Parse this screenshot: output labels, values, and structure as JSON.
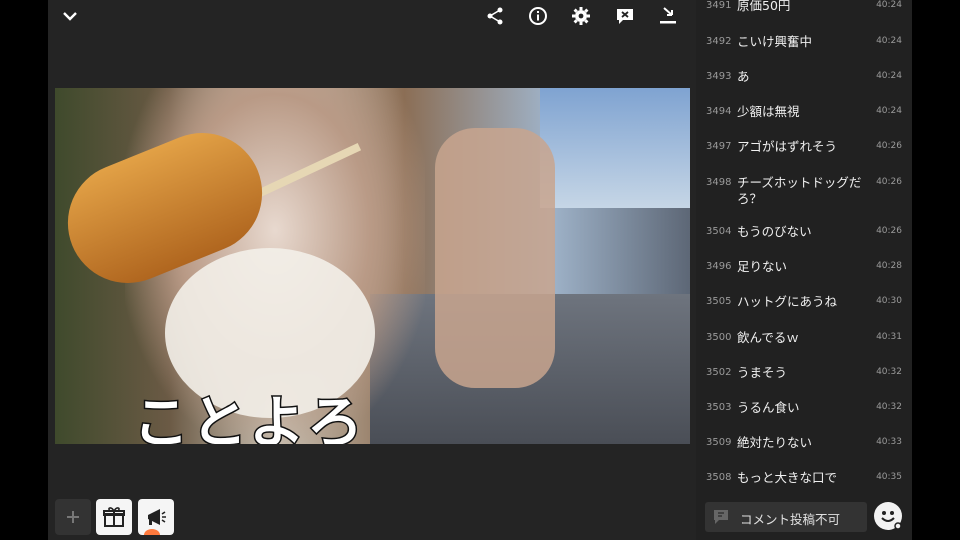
{
  "comments": [
    {
      "num": "3491",
      "text": "原価50円",
      "time": "40:24"
    },
    {
      "num": "3492",
      "text": "こいけ興奮中",
      "time": "40:24"
    },
    {
      "num": "3493",
      "text": "あ",
      "time": "40:24"
    },
    {
      "num": "3494",
      "text": "少額は無視",
      "time": "40:24"
    },
    {
      "num": "3497",
      "text": "アゴがはずれそう",
      "time": "40:26"
    },
    {
      "num": "3498",
      "text": "チーズホットドッグだろ？",
      "time": "40:26"
    },
    {
      "num": "3504",
      "text": "もうのびない",
      "time": "40:26"
    },
    {
      "num": "3496",
      "text": "足りない",
      "time": "40:28"
    },
    {
      "num": "3505",
      "text": "ハットグにあうね",
      "time": "40:30"
    },
    {
      "num": "3500",
      "text": "飲んでるｗ",
      "time": "40:31"
    },
    {
      "num": "3502",
      "text": "うまそう",
      "time": "40:32"
    },
    {
      "num": "3503",
      "text": "うるん食い",
      "time": "40:32"
    },
    {
      "num": "3509",
      "text": "絶対たりない",
      "time": "40:33"
    },
    {
      "num": "3508",
      "text": "もっと大きな口で",
      "time": "40:35"
    }
  ],
  "video": {
    "caption": "ことよろ"
  },
  "comment_input": {
    "label": "コメント投稿不可"
  },
  "icons": {
    "collapse": "chevron-down-icon",
    "share": "share-icon",
    "info": "info-icon",
    "settings": "gear-icon",
    "hide_comments": "comment-off-icon",
    "pip": "minimize-icon",
    "add": "plus-icon",
    "gift": "gift-icon",
    "ad": "megaphone-icon",
    "emoji": "emoji-icon"
  },
  "colors": {
    "panel": "#212121",
    "player_bg": "#242424",
    "accent": "#ff7a3d"
  }
}
